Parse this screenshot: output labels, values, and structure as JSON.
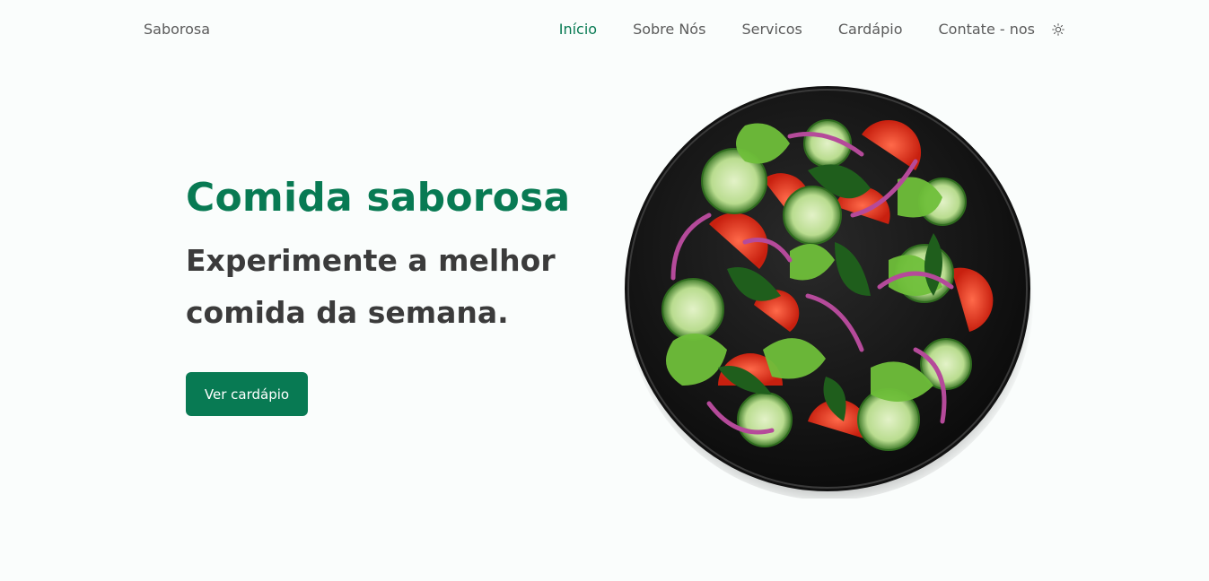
{
  "brand": "Saborosa",
  "nav": {
    "items": [
      {
        "label": "Início",
        "active": true
      },
      {
        "label": "Sobre Nós",
        "active": false
      },
      {
        "label": "Servicos",
        "active": false
      },
      {
        "label": "Cardápio",
        "active": false
      },
      {
        "label": "Contate - nos",
        "active": false
      }
    ],
    "theme_icon": "sun-icon"
  },
  "hero": {
    "title": "Comida saborosa",
    "subtitle_line1": "Experimente a melhor",
    "subtitle_line2": "comida da semana.",
    "cta_label": "Ver cardápio",
    "image": "salad-plate-image"
  },
  "colors": {
    "accent": "#087a53",
    "text": "#3b3b3b",
    "background": "#fafdfc"
  }
}
